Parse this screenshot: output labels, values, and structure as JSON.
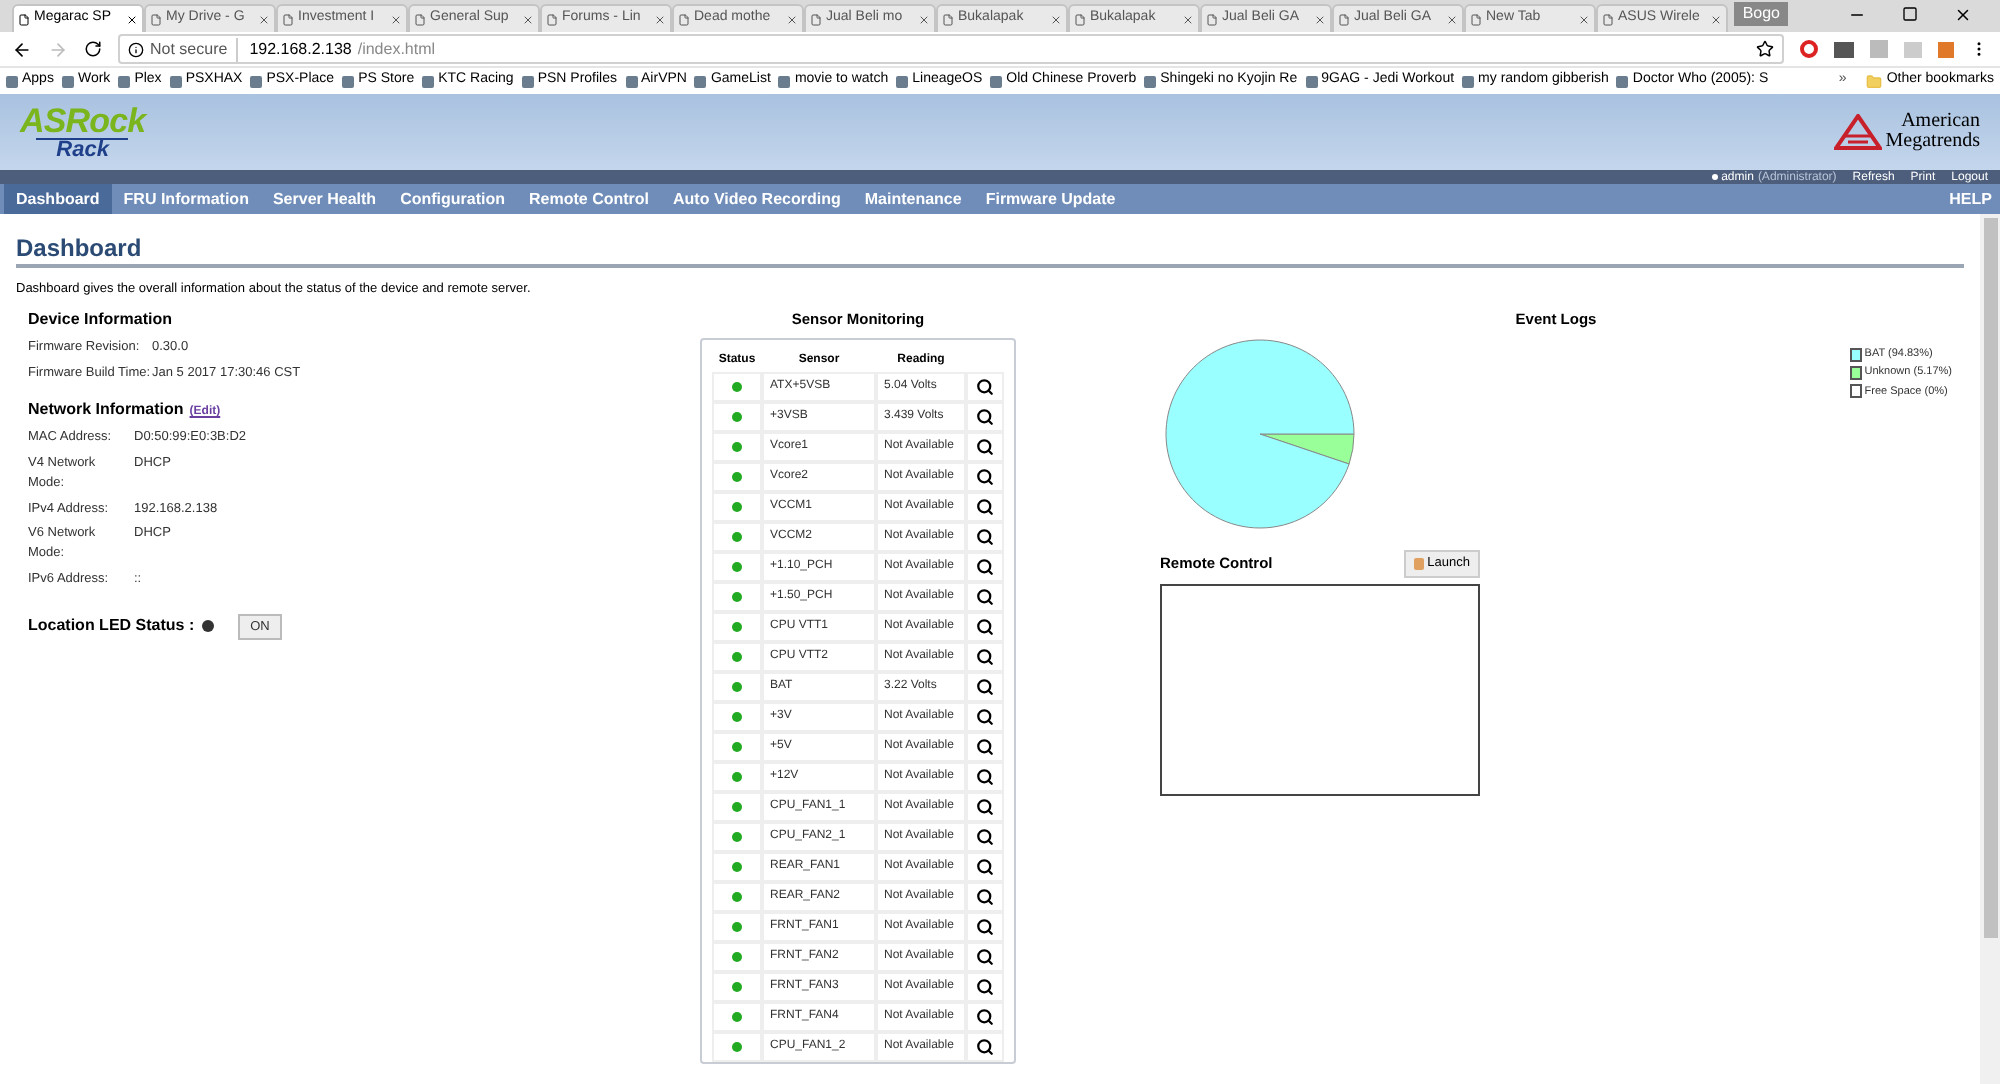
{
  "browser": {
    "tabs": [
      {
        "title": "Megarac SP",
        "selected": true
      },
      {
        "title": "My Drive - G",
        "selected": false
      },
      {
        "title": "Investment I",
        "selected": false
      },
      {
        "title": "General Sup",
        "selected": false
      },
      {
        "title": "Forums - Lin",
        "selected": false
      },
      {
        "title": "Dead mothe",
        "selected": false
      },
      {
        "title": "Jual Beli mo",
        "selected": false
      },
      {
        "title": "Bukalapak",
        "selected": false
      },
      {
        "title": "Bukalapak",
        "selected": false
      },
      {
        "title": "Jual Beli GA",
        "selected": false
      },
      {
        "title": "Jual Beli GA",
        "selected": false
      },
      {
        "title": "New Tab",
        "selected": false
      },
      {
        "title": "ASUS Wirele",
        "selected": false
      }
    ],
    "profile": "Bogo",
    "security": "Not secure",
    "url_host": "192.168.2.138",
    "url_path": "/index.html",
    "bookmarks": [
      "Apps",
      "Work",
      "Plex",
      "PSXHAX",
      "PSX-Place",
      "PS Store",
      "KTC Racing",
      "PSN Profiles",
      "AirVPN",
      "GameList",
      "movie to watch",
      "LineageOS",
      "Old Chinese Proverb",
      "Shingeki no Kyojin Re",
      "9GAG - Jedi Workout",
      "my random gibberish",
      "Doctor Who (2005): S"
    ],
    "more_bookmarks": "»",
    "other_bookmarks": "Other bookmarks"
  },
  "header": {
    "logo_top": "ASRock",
    "logo_bottom": "Rack",
    "vendor_line1": "American",
    "vendor_line2": "Megatrends",
    "user": "admin",
    "role": "(Administrator)",
    "actions": [
      "Refresh",
      "Print",
      "Logout"
    ]
  },
  "nav": {
    "items": [
      {
        "label": "Dashboard",
        "selected": true
      },
      {
        "label": "FRU Information",
        "selected": false
      },
      {
        "label": "Server Health",
        "selected": false
      },
      {
        "label": "Configuration",
        "selected": false
      },
      {
        "label": "Remote Control",
        "selected": false
      },
      {
        "label": "Auto Video Recording",
        "selected": false
      },
      {
        "label": "Maintenance",
        "selected": false
      },
      {
        "label": "Firmware Update",
        "selected": false
      }
    ],
    "help": "HELP"
  },
  "page": {
    "title": "Dashboard",
    "description": "Dashboard gives the overall information about the status of the device and remote server."
  },
  "device_info": {
    "title": "Device Information",
    "rows": [
      {
        "label": "Firmware Revision:",
        "value": "0.30.0"
      },
      {
        "label": "Firmware Build Time:",
        "value": "Jan 5 2017 17:30:46 CST"
      }
    ]
  },
  "network_info": {
    "title": "Network Information",
    "edit_link": "(Edit)",
    "rows": [
      {
        "label": "MAC Address:",
        "value": "D0:50:99:E0:3B:D2"
      },
      {
        "label": "V4 Network Mode:",
        "value": "DHCP"
      },
      {
        "label": "IPv4 Address:",
        "value": "192.168.2.138"
      },
      {
        "label": "V6 Network Mode:",
        "value": "DHCP"
      },
      {
        "label": "IPv6 Address:",
        "value": "::"
      }
    ]
  },
  "location_led": {
    "label": "Location LED Status :",
    "on": false,
    "button": "ON"
  },
  "sensors": {
    "title": "Sensor Monitoring",
    "columns": [
      "Status",
      "Sensor",
      "Reading"
    ],
    "rows": [
      {
        "sensor": "ATX+5VSB",
        "reading": "5.04 Volts",
        "color": "#22aa22"
      },
      {
        "sensor": "+3VSB",
        "reading": "3.439 Volts",
        "color": "#22aa22"
      },
      {
        "sensor": "Vcore1",
        "reading": "Not Available",
        "color": "#22aa22"
      },
      {
        "sensor": "Vcore2",
        "reading": "Not Available",
        "color": "#22aa22"
      },
      {
        "sensor": "VCCM1",
        "reading": "Not Available",
        "color": "#22aa22"
      },
      {
        "sensor": "VCCM2",
        "reading": "Not Available",
        "color": "#22aa22"
      },
      {
        "sensor": "+1.10_PCH",
        "reading": "Not Available",
        "color": "#22aa22"
      },
      {
        "sensor": "+1.50_PCH",
        "reading": "Not Available",
        "color": "#22aa22"
      },
      {
        "sensor": "CPU VTT1",
        "reading": "Not Available",
        "color": "#22aa22"
      },
      {
        "sensor": "CPU VTT2",
        "reading": "Not Available",
        "color": "#22aa22"
      },
      {
        "sensor": "BAT",
        "reading": "3.22 Volts",
        "color": "#22aa22"
      },
      {
        "sensor": "+3V",
        "reading": "Not Available",
        "color": "#22aa22"
      },
      {
        "sensor": "+5V",
        "reading": "Not Available",
        "color": "#22aa22"
      },
      {
        "sensor": "+12V",
        "reading": "Not Available",
        "color": "#22aa22"
      },
      {
        "sensor": "CPU_FAN1_1",
        "reading": "Not Available",
        "color": "#22aa22"
      },
      {
        "sensor": "CPU_FAN2_1",
        "reading": "Not Available",
        "color": "#22aa22"
      },
      {
        "sensor": "REAR_FAN1",
        "reading": "Not Available",
        "color": "#22aa22"
      },
      {
        "sensor": "REAR_FAN2",
        "reading": "Not Available",
        "color": "#22aa22"
      },
      {
        "sensor": "FRNT_FAN1",
        "reading": "Not Available",
        "color": "#22aa22"
      },
      {
        "sensor": "FRNT_FAN2",
        "reading": "Not Available",
        "color": "#22aa22"
      },
      {
        "sensor": "FRNT_FAN3",
        "reading": "Not Available",
        "color": "#22aa22"
      },
      {
        "sensor": "FRNT_FAN4",
        "reading": "Not Available",
        "color": "#22aa22"
      },
      {
        "sensor": "CPU_FAN1_2",
        "reading": "Not Available",
        "color": "#22aa22"
      }
    ]
  },
  "event_logs": {
    "title": "Event Logs",
    "chart_data": {
      "type": "pie",
      "categories": [
        "BAT (94.83%)",
        "Unknown (5.17%)",
        "Free Space (0%)"
      ],
      "values": [
        94.83,
        5.17,
        0
      ],
      "colors": [
        "#99ffff",
        "#99ff99",
        "#ffffff"
      ]
    }
  },
  "remote_control": {
    "title": "Remote Control",
    "button": "Launch"
  }
}
